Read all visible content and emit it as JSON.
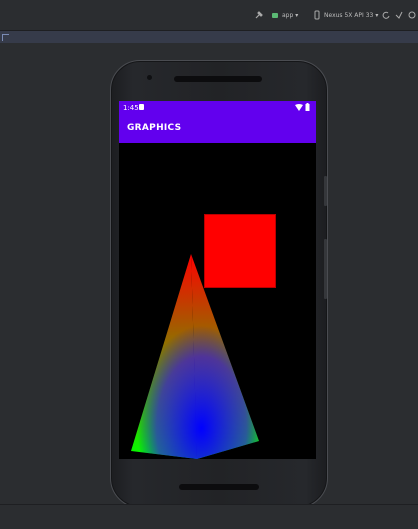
{
  "ide": {
    "run_config": "app",
    "device": "Nexus 5X API 33",
    "colors": {
      "background": "#2b2d30",
      "accent": "#6200ee"
    }
  },
  "phone": {
    "status": {
      "time": "1:45"
    },
    "app_bar": {
      "title": "GRAPHICS"
    },
    "canvas": {
      "square_color": "#ff0000",
      "pyramid_colors": [
        "#ff0000",
        "#00ff00",
        "#0000ff"
      ]
    }
  }
}
